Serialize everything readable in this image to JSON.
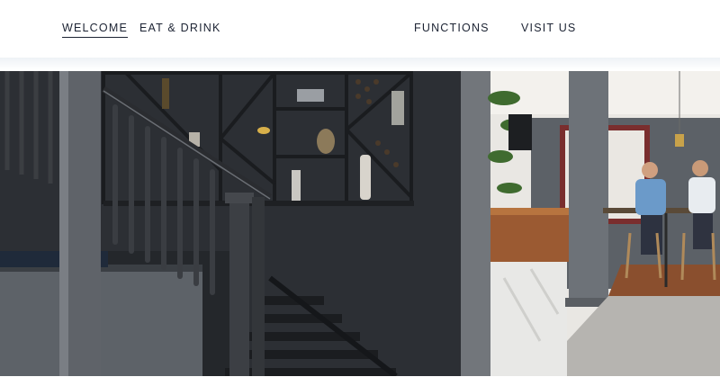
{
  "nav": {
    "items": [
      {
        "label": "WELCOME",
        "active": true
      },
      {
        "label": "EAT & DRINK",
        "active": false
      },
      {
        "label": "FUNCTIONS",
        "active": false
      },
      {
        "label": "VISIT US",
        "active": false
      }
    ]
  },
  "hero": {
    "description_icon": "hero-photo"
  },
  "colors": {
    "nav_text": "#1c2333",
    "wall_dark": "#2b2e33",
    "background": "#ffffff"
  }
}
